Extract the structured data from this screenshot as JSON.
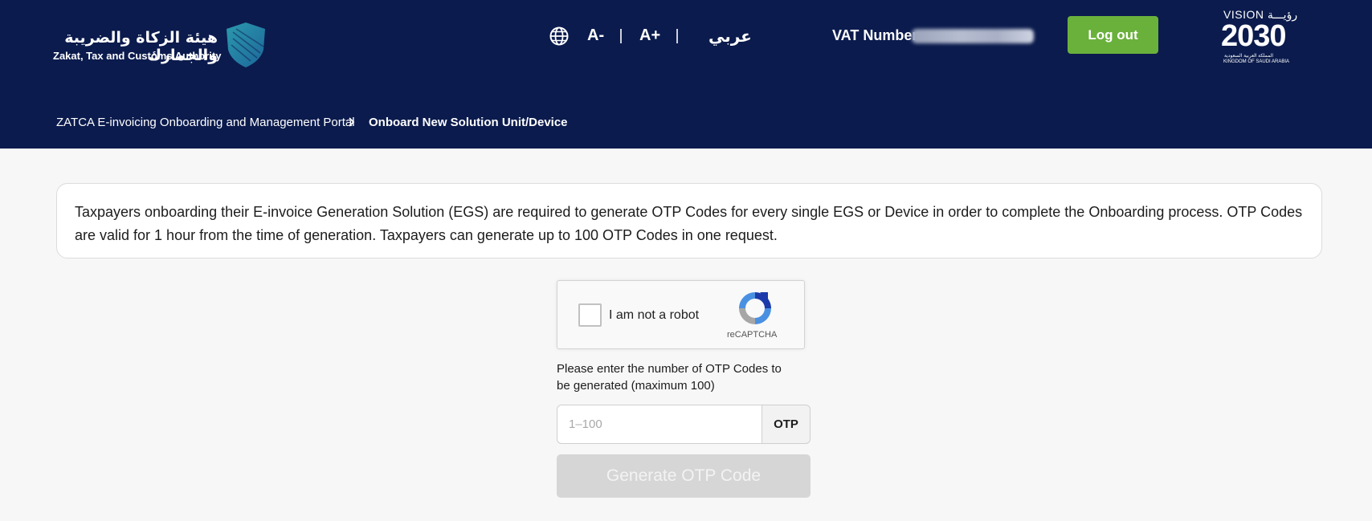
{
  "header": {
    "org_name_ar": "هيئة الزكاة والضريبة والجمارك",
    "org_name_en": "Zakat, Tax and Customs Authority",
    "icons": {
      "language": "globe-icon",
      "logo": "shield-logo-icon"
    },
    "font_decrease": "A-",
    "font_increase": "A+",
    "language_toggle": "عربي",
    "vat_label": "VAT Number",
    "logout_label": "Log out",
    "vision": {
      "top": "VISION رؤيـــة",
      "number": "2030",
      "ar": "المملكة العربية السعودية",
      "en": "KINGDOM OF SAUDI ARABIA"
    }
  },
  "breadcrumb": {
    "items": [
      "ZATCA E-invoicing Onboarding and Management Portal",
      "Onboard New Solution Unit/Device"
    ]
  },
  "notice": {
    "text": "Taxpayers onboarding their E-invoice Generation Solution (EGS) are required to generate OTP Codes for every single EGS or Device in order to complete the Onboarding process.  OTP Codes are valid for 1 hour from the time of generation.  Taxpayers can generate up to 100 OTP Codes in one request."
  },
  "captcha": {
    "label": "I am not a robot",
    "brand": "reCAPTCHA"
  },
  "form": {
    "instruction": "Please enter the number of OTP Codes to be generated (maximum 100)",
    "otp_placeholder": "1–100",
    "otp_value": "",
    "otp_addon": "OTP",
    "generate_label": "Generate OTP Code"
  },
  "colors": {
    "header_bg": "#0b1b4d",
    "logout_bg": "#6ab13c",
    "disabled_btn": "#d6d6d6",
    "page_bg": "#f7f7f7"
  }
}
